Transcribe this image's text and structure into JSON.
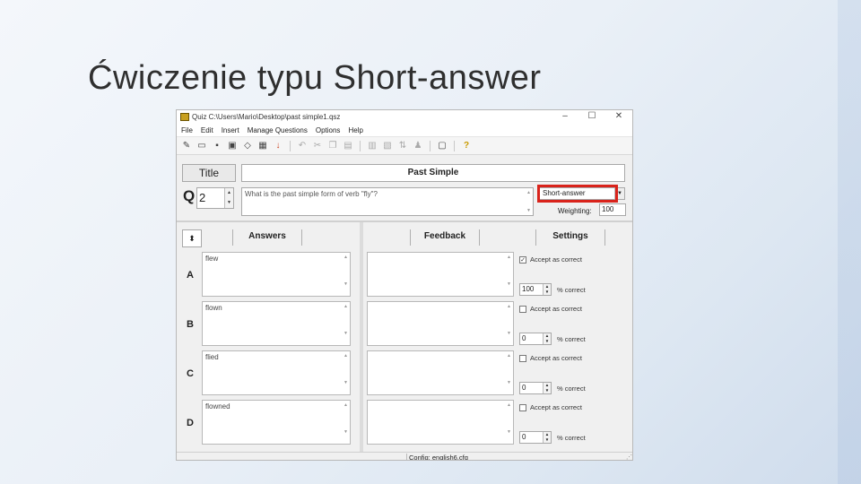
{
  "slide": {
    "title": "Ćwiczenie typu Short-answer"
  },
  "window": {
    "title": "Quiz C:\\Users\\Mario\\Desktop\\past simple1.qsz",
    "controls": {
      "minimize": "–",
      "maximize": "☐",
      "close": "✕"
    }
  },
  "menu": [
    "File",
    "Edit",
    "Insert",
    "Manage Questions",
    "Options",
    "Help"
  ],
  "editor": {
    "title_button": "Title",
    "title_value": "Past Simple",
    "q_label": "Q",
    "q_number": "2",
    "question_text": "What is the past simple form of verb \"fly\"?",
    "question_type": "Short-answer",
    "weighting_label": "Weighting:",
    "weighting_value": "100"
  },
  "columns": {
    "answers": "Answers",
    "feedback": "Feedback",
    "settings": "Settings"
  },
  "rows": [
    {
      "letter": "A",
      "answer": "flew",
      "accept_label": "Accept as correct",
      "accepted": true,
      "percent": "100",
      "percent_label": "% correct"
    },
    {
      "letter": "B",
      "answer": "flown",
      "accept_label": "Accept as correct",
      "accepted": false,
      "percent": "0",
      "percent_label": "% correct"
    },
    {
      "letter": "C",
      "answer": "flied",
      "accept_label": "Accept as correct",
      "accepted": false,
      "percent": "0",
      "percent_label": "% correct"
    },
    {
      "letter": "D",
      "answer": "flowned",
      "accept_label": "Accept as correct",
      "accepted": false,
      "percent": "0",
      "percent_label": "% correct"
    }
  ],
  "status": {
    "config": "Config: english6.cfq"
  },
  "colors": {
    "highlight": "#d9231b"
  }
}
